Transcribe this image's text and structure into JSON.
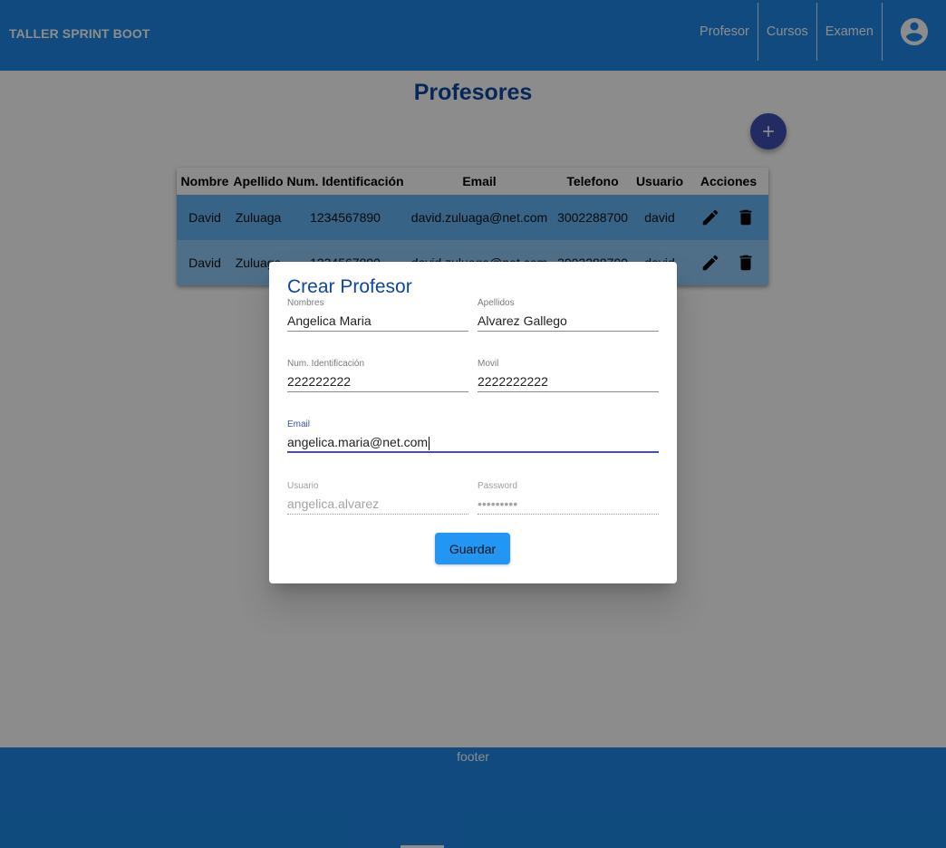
{
  "header": {
    "brand": "TALLER SPRINT BOOT",
    "nav": [
      "Profesor",
      "Cursos",
      "Examen"
    ],
    "account_icon": "account-circle-icon"
  },
  "page": {
    "title": "Profesores",
    "add_icon": "plus-icon"
  },
  "table": {
    "columns": [
      "Nombre",
      "Apellido",
      "Num. Identificación",
      "Email",
      "Telefono",
      "Usuario",
      "Acciones"
    ],
    "rows": [
      {
        "nombre": "David",
        "apellido": "Zuluaga",
        "identificacion": "1234567890",
        "email": "david.zuluaga@net.com",
        "telefono": "3002288700",
        "usuario": "david"
      },
      {
        "nombre": "David",
        "apellido": "Zuluaga",
        "identificacion": "1234567890",
        "email": "david.zuluaga@net.com",
        "telefono": "3002288700",
        "usuario": "david"
      }
    ],
    "row_colors": [
      "#64b5f6",
      "#90caf9"
    ]
  },
  "dialog": {
    "title": "Crear Profesor",
    "fields": {
      "nombres": {
        "label": "Nombres",
        "value": "Angelica Maria"
      },
      "apellidos": {
        "label": "Apellidos",
        "value": "Alvarez Gallego"
      },
      "identificacion": {
        "label": "Num. Identificación",
        "value": "222222222"
      },
      "movil": {
        "label": "Movil",
        "value": "2222222222"
      },
      "email": {
        "label": "Email",
        "value": "angelica.maria@net.com"
      },
      "usuario": {
        "label": "Usuario",
        "value": "angelica.alvarez"
      },
      "password": {
        "label": "Password",
        "value": "•••••••••"
      }
    },
    "save_label": "Guardar"
  },
  "footer": {
    "text": "footer"
  },
  "colors": {
    "primary": "#1e88e5",
    "title": "#0d47a1",
    "fab": "#3f51b5",
    "button": "#2196f3"
  }
}
